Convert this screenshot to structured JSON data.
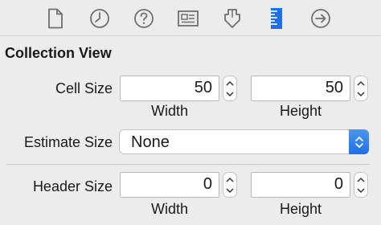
{
  "toolbar": {
    "icons": [
      {
        "name": "file-inspector-icon"
      },
      {
        "name": "history-inspector-icon"
      },
      {
        "name": "quick-help-icon"
      },
      {
        "name": "identity-inspector-icon"
      },
      {
        "name": "attributes-inspector-icon"
      },
      {
        "name": "size-inspector-icon",
        "selected": true
      },
      {
        "name": "connections-inspector-icon"
      }
    ],
    "accent_color": "#1d6ff2"
  },
  "section": {
    "title": "Collection View"
  },
  "cell_size": {
    "label": "Cell Size",
    "width_value": "50",
    "height_value": "50",
    "width_label": "Width",
    "height_label": "Height"
  },
  "estimate_size": {
    "label": "Estimate Size",
    "selected": "None"
  },
  "header_size": {
    "label": "Header Size",
    "width_value": "0",
    "height_value": "0",
    "width_label": "Width",
    "height_label": "Height"
  }
}
